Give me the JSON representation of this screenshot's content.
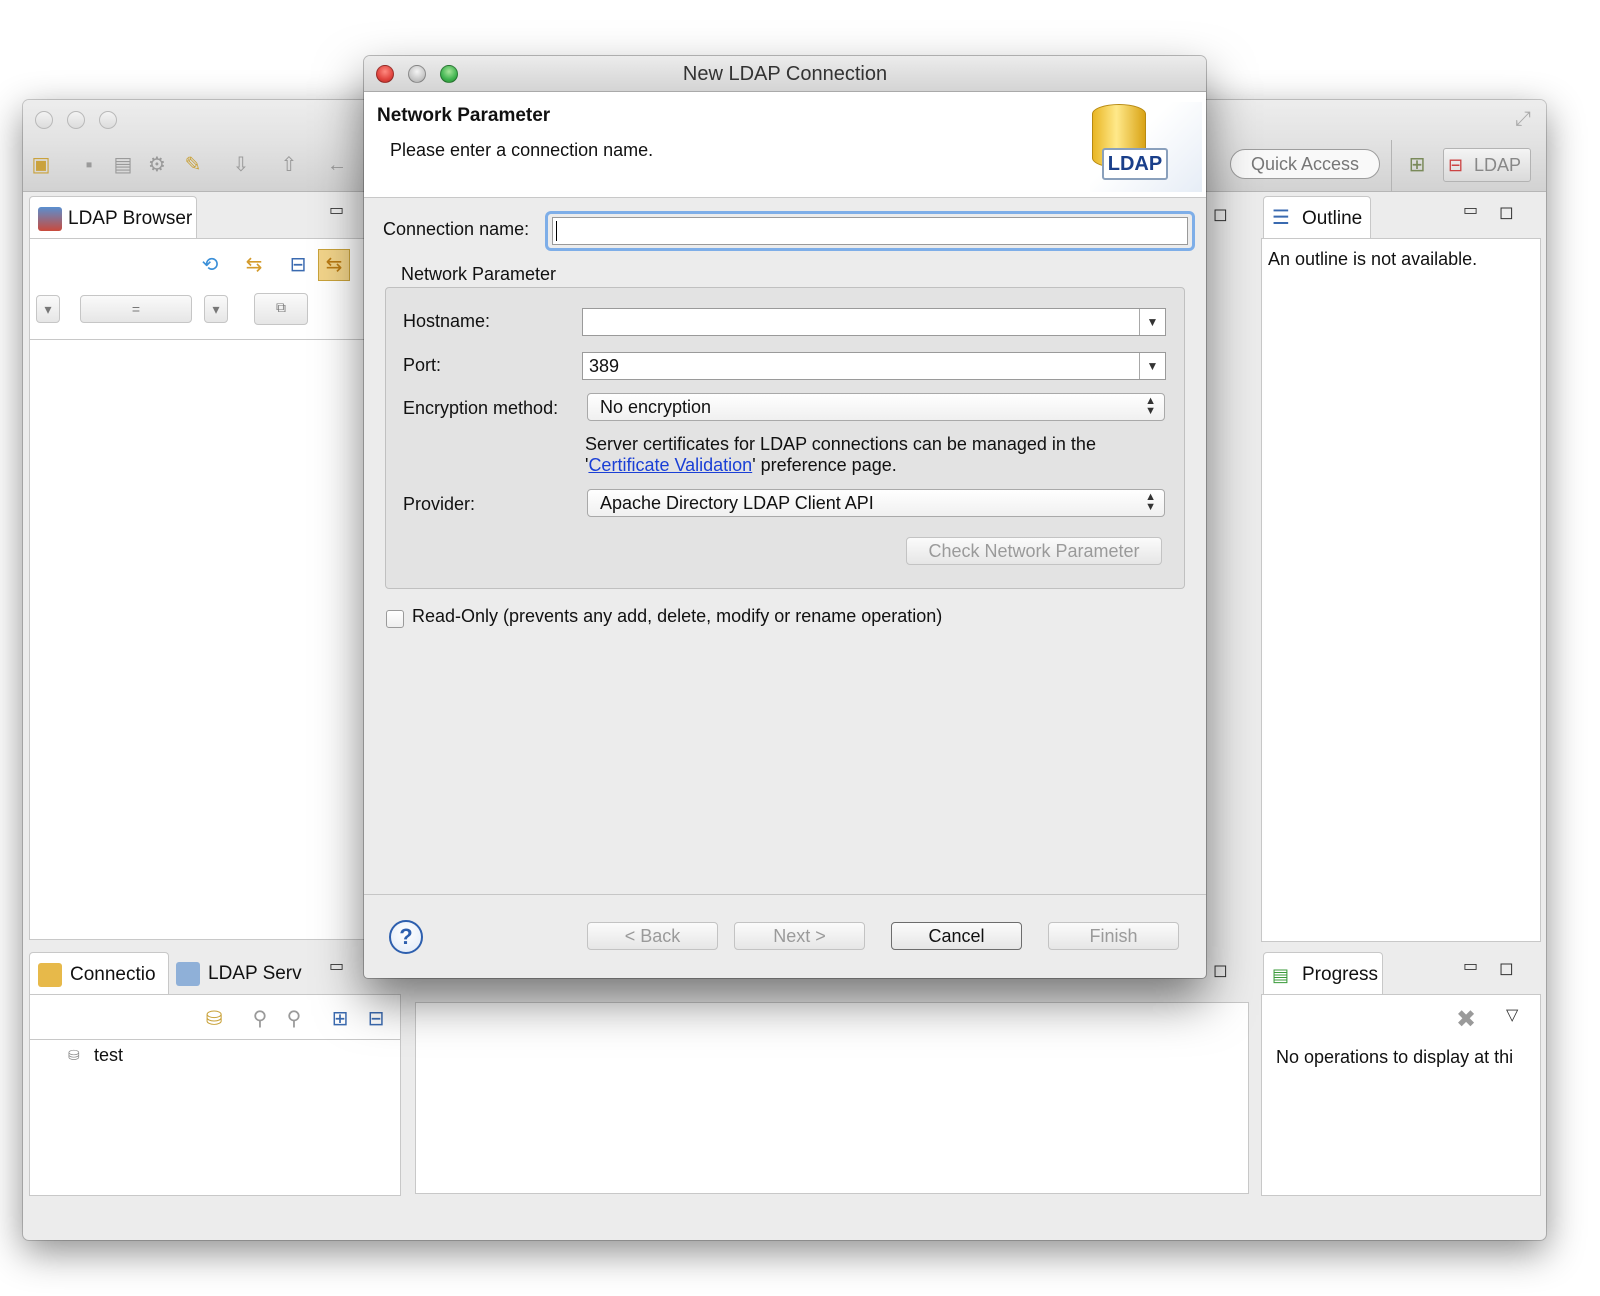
{
  "main_window": {
    "toolbar": {
      "quick_access_placeholder": "Quick Access",
      "perspective_label": "LDAP"
    },
    "ldap_browser": {
      "tab_label": "LDAP Browser",
      "filter_operator": "="
    },
    "outline": {
      "tab_label": "Outline",
      "message": "An outline is not available."
    },
    "connections": {
      "tab_label": "Connectio",
      "servers_tab_label": "LDAP Serv",
      "items": [
        {
          "label": "test"
        }
      ]
    },
    "progress": {
      "tab_label": "Progress",
      "message": "No operations to display at thi"
    }
  },
  "dialog": {
    "title": "New LDAP Connection",
    "header_title": "Network Parameter",
    "header_message": "Please enter a connection name.",
    "logo_text": "LDAP",
    "connection_name_label": "Connection name:",
    "connection_name_value": "",
    "group_title": "Network Parameter",
    "hostname_label": "Hostname:",
    "hostname_value": "",
    "port_label": "Port:",
    "port_value": "389",
    "encryption_label": "Encryption method:",
    "encryption_value": "No encryption",
    "cert_note_line1": "Server certificates for LDAP connections can be managed in the",
    "cert_note_quote_open": "'",
    "cert_link": "Certificate Validation",
    "cert_note_line2": "' preference page.",
    "provider_label": "Provider:",
    "provider_value": "Apache Directory LDAP Client API",
    "check_button": "Check Network Parameter",
    "readonly_label": "Read-Only (prevents any add, delete, modify or rename operation)",
    "readonly_checked": false,
    "buttons": {
      "help": "?",
      "back": "< Back",
      "next": "Next >",
      "cancel": "Cancel",
      "finish": "Finish"
    }
  },
  "colors": {
    "focus_ring": "#7eaee8",
    "link": "#1a3fd6",
    "close_light": "#e0443e",
    "minimize_light": "#c8c8c8",
    "zoom_light": "#3fb34f"
  }
}
